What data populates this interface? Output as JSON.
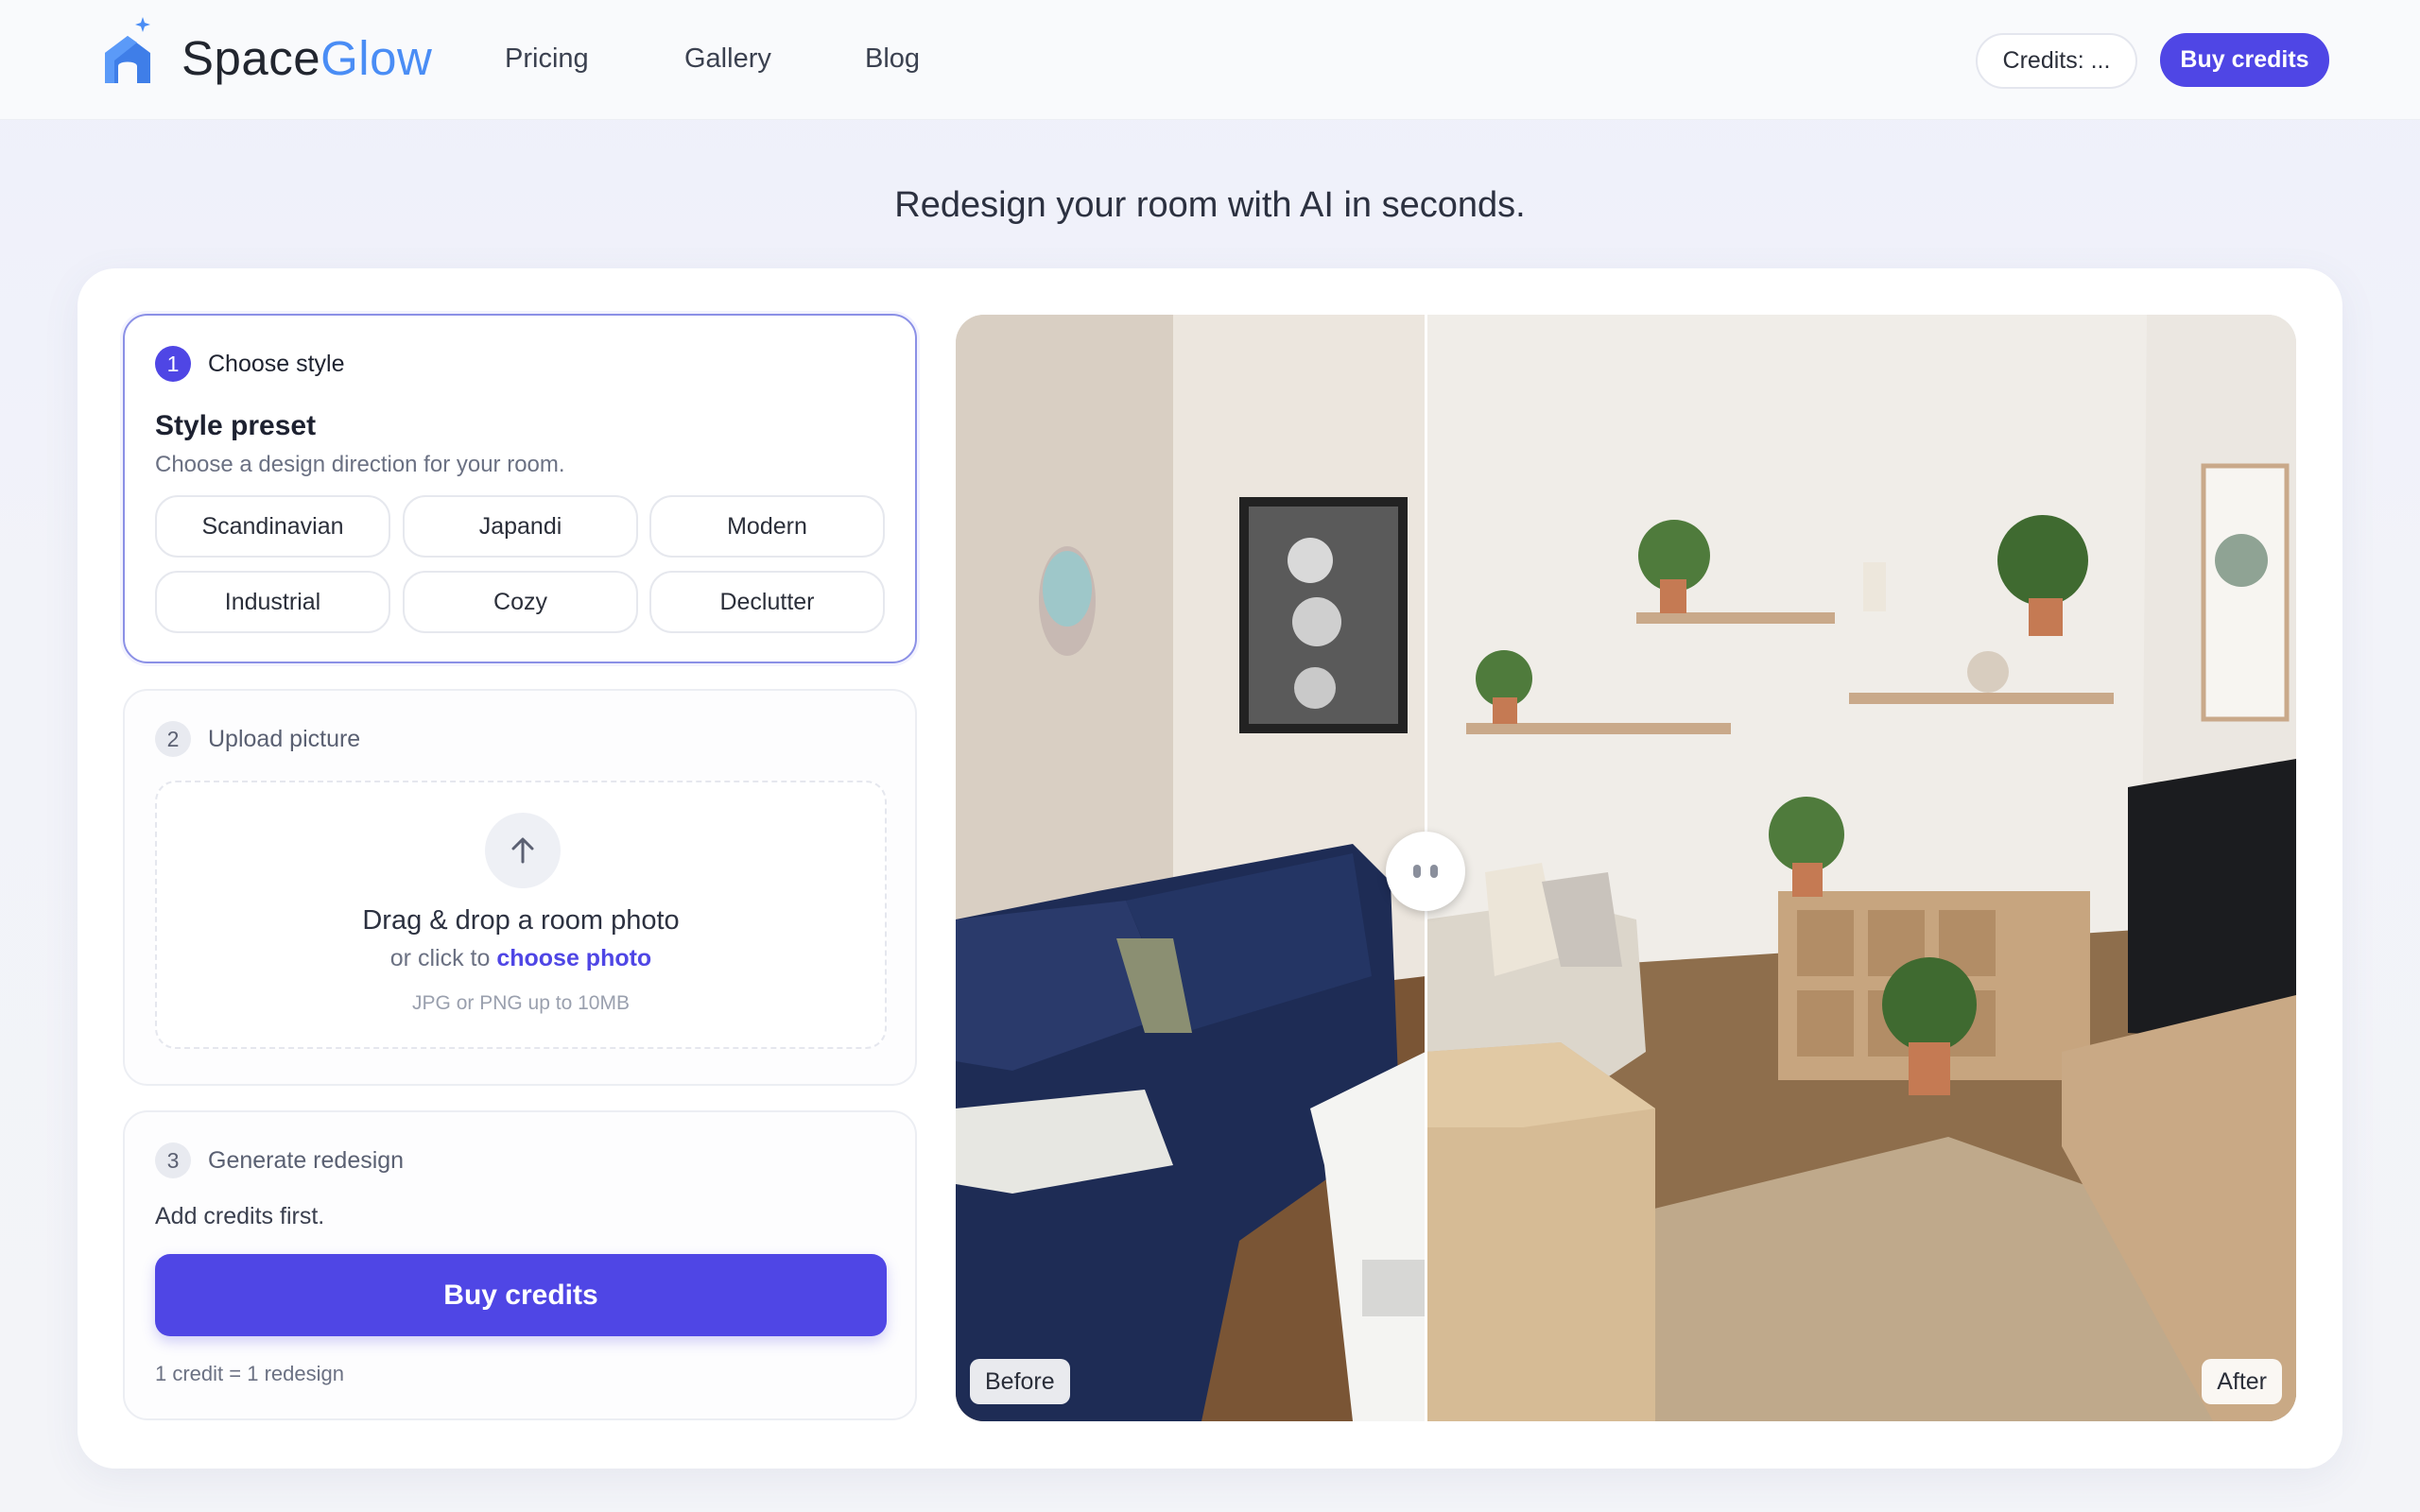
{
  "brand": {
    "name_part1": "Space",
    "name_part2": "Glow",
    "logo_icon": "house-sparkle-icon"
  },
  "nav": {
    "items": [
      "Pricing",
      "Gallery",
      "Blog"
    ]
  },
  "header": {
    "credits_label": "Credits: ...",
    "buy_label": "Buy credits"
  },
  "tagline": "Redesign your room with AI in seconds.",
  "step1": {
    "number": "1",
    "title": "Choose style",
    "preset_title": "Style preset",
    "preset_subtitle": "Choose a design direction for your room.",
    "presets": [
      "Scandinavian",
      "Japandi",
      "Modern",
      "Industrial",
      "Cozy",
      "Declutter"
    ]
  },
  "step2": {
    "number": "2",
    "title": "Upload picture",
    "upload_icon": "arrow-up-icon",
    "drop_title": "Drag & drop a room photo",
    "drop_sub_prefix": "or click to",
    "drop_sub_link": "choose photo",
    "drop_hint": "JPG or PNG up to 10MB"
  },
  "step3": {
    "number": "3",
    "title": "Generate redesign",
    "message": "Add credits first.",
    "button_label": "Buy credits",
    "note": "1 credit = 1 redesign"
  },
  "compare": {
    "before_label": "Before",
    "after_label": "After",
    "slider_position": 0.35
  },
  "colors": {
    "accent": "#4f46e5",
    "brand_blue": "#4a8df5",
    "background": "#f2f3f9"
  }
}
